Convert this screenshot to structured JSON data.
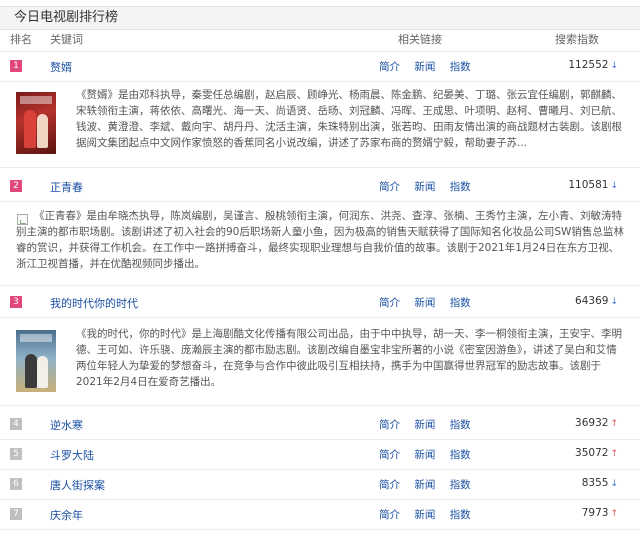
{
  "page_title": "今日电视剧排行榜",
  "columns": {
    "rank": "排名",
    "keyword": "关键词",
    "links": "相关链接",
    "index": "搜索指数"
  },
  "link_labels": {
    "intro": "简介",
    "news": "新闻",
    "index": "指数"
  },
  "colors": {
    "top_rank_badge": "#e1487d",
    "normal_rank_badge": "#bfbfbf",
    "link": "#1a4fa3",
    "trend_down": "#3a6fd8",
    "trend_up": "#e15050"
  },
  "rows": [
    {
      "rank": "1",
      "keyword": "赘婿",
      "index": "112552",
      "trend": "down",
      "description": "《赘婿》是由邓科执导，秦雯任总编剧，赵启辰、顾峥光、杨雨晨、陈金鹏、纪晏美、丁璐、张云宜任编剧，郭麒麟、宋轶领衔主演，蒋依依、高曙光、海一天、尚语贤、岳旸、刘冠麟、冯晖、王成思、叶项明、赵柯、曹曦月、刘已航、钱波、黄澄澄、李斌、戴向宇、胡丹丹、沈活主演，朱珠特别出演，张若昀、田雨友情出演的商战题材古装剧。该剧根据阅文集团起点中文网作家愤怒的香蕉同名小说改编，讲述了苏家布商的赘婿宁毅，帮助妻子苏..."
    },
    {
      "rank": "2",
      "keyword": "正青春",
      "index": "110581",
      "trend": "down",
      "description": "《正青春》是由牟晓杰执导，陈岚编剧，吴谨言、殷桃领衔主演，何润东、洪尧、查淳、张楠、王秀竹主演，左小青、刘敏涛特别主演的都市职场剧。该剧讲述了初入社会的90后职场新人童小鱼，因为极高的销售天赋获得了国际知名化妆品公司SW销售总监林睿的赏识，并获得工作机会。在工作中一路拼搏奋斗，最终实现职业理想与自我价值的故事。该剧于2021年1月24日在东方卫视、浙江卫视首播，并在优酷视频同步播出。"
    },
    {
      "rank": "3",
      "keyword": "我的时代你的时代",
      "index": "64369",
      "trend": "down",
      "description": "《我的时代，你的时代》是上海剧酷文化传播有限公司出品，由于中中执导，胡一天、李一桐领衔主演，王安宇、李明德、王可如、许乐骁、庞瀚辰主演的都市励志剧。该剧改编自墨宝非宝所著的小说《密室因游鱼》，讲述了吴白和艾情两位年轻人为挚爱的梦想奋斗，在竞争与合作中彼此吸引互相扶持，携手为中国赢得世界冠军的励志故事。该剧于2021年2月4日在爱奇艺播出。"
    },
    {
      "rank": "4",
      "keyword": "逆水寒",
      "index": "36932",
      "trend": "up"
    },
    {
      "rank": "5",
      "keyword": "斗罗大陆",
      "index": "35072",
      "trend": "up"
    },
    {
      "rank": "6",
      "keyword": "唐人街探案",
      "index": "8355",
      "trend": "down"
    },
    {
      "rank": "7",
      "keyword": "庆余年",
      "index": "7973",
      "trend": "up"
    }
  ]
}
